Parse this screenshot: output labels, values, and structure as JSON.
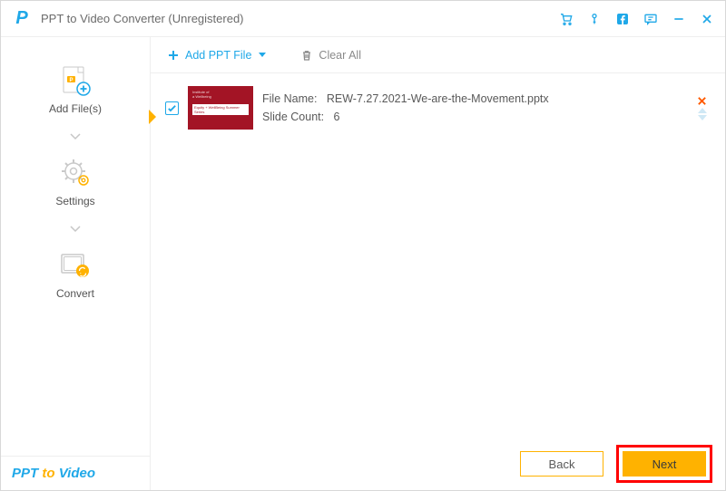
{
  "titlebar": {
    "app_name": "PPT to Video Converter (Unregistered)"
  },
  "sidebar": {
    "add_files_label": "Add File(s)",
    "settings_label": "Settings",
    "convert_label": "Convert",
    "footer_ppt": "PPT",
    "footer_to": "to",
    "footer_video": "Video"
  },
  "toolbar": {
    "add_ppt_label": "Add PPT File",
    "clear_all_label": "Clear All"
  },
  "filelist": {
    "items": [
      {
        "file_name_label": "File Name:",
        "file_name": "REW-7.27.2021-We-are-the-Movement.pptx",
        "slide_count_label": "Slide Count:",
        "slide_count": "6",
        "checked": true
      }
    ]
  },
  "footer": {
    "back_label": "Back",
    "next_label": "Next"
  }
}
